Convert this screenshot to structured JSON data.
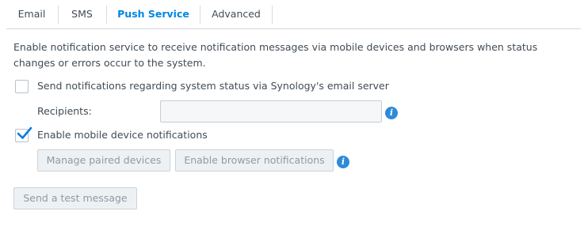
{
  "tabs": [
    {
      "label": "Email"
    },
    {
      "label": "SMS"
    },
    {
      "label": "Push Service"
    },
    {
      "label": "Advanced"
    }
  ],
  "active_tab": "Push Service",
  "description": "Enable notification service to receive notification messages via mobile devices and browsers when status changes or errors occur to the system.",
  "system_status": {
    "label": "Send notifications regarding system status via Synology's email server",
    "checked": false
  },
  "recipients": {
    "label": "Recipients:",
    "value": ""
  },
  "mobile": {
    "label": "Enable mobile device notifications",
    "checked": true
  },
  "buttons": {
    "manage_paired": "Manage paired devices",
    "enable_browser": "Enable browser notifications",
    "send_test": "Send a test message"
  },
  "info_icon": "info-icon",
  "colors": {
    "accent": "#0086e5",
    "checkmark": "#0a7ce0",
    "info": "#2f8ad8"
  }
}
